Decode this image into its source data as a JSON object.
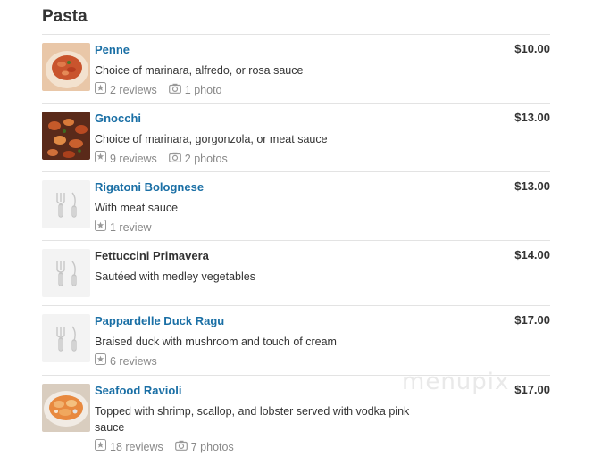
{
  "section": {
    "title": "Pasta"
  },
  "watermark": "menupix",
  "items": [
    {
      "name": "Penne",
      "description": "Choice of marinara, alfredo, or rosa sauce",
      "price": "$10.00",
      "reviews": "2 reviews",
      "photos": "1 photo",
      "image": "photo"
    },
    {
      "name": "Gnocchi",
      "description": "Choice of marinara, gorgonzola, or meat sauce",
      "price": "$13.00",
      "reviews": "9 reviews",
      "photos": "2 photos",
      "image": "photo"
    },
    {
      "name": "Rigatoni Bolognese",
      "description": "With meat sauce",
      "price": "$13.00",
      "reviews": "1 review",
      "photos": "",
      "image": "placeholder"
    },
    {
      "name": "Fettuccini Primavera",
      "description": "Sautéed with medley vegetables",
      "price": "$14.00",
      "reviews": "",
      "photos": "",
      "image": "placeholder"
    },
    {
      "name": "Pappardelle Duck Ragu",
      "description": "Braised duck with mushroom and touch of cream",
      "price": "$17.00",
      "reviews": "6 reviews",
      "photos": "",
      "image": "placeholder"
    },
    {
      "name": "Seafood Ravioli",
      "description": "Topped with shrimp, scallop, and lobster served with vodka pink sauce",
      "price": "$17.00",
      "reviews": "18 reviews",
      "photos": "7 photos",
      "image": "photo"
    }
  ],
  "colors": {
    "link": "#1a6fa5",
    "text": "#333333",
    "muted": "#888888",
    "divider": "#e3e3e3"
  },
  "icons": {
    "review": "star-badge-icon",
    "photo": "camera-icon",
    "placeholder": "fork-knife-icon"
  }
}
